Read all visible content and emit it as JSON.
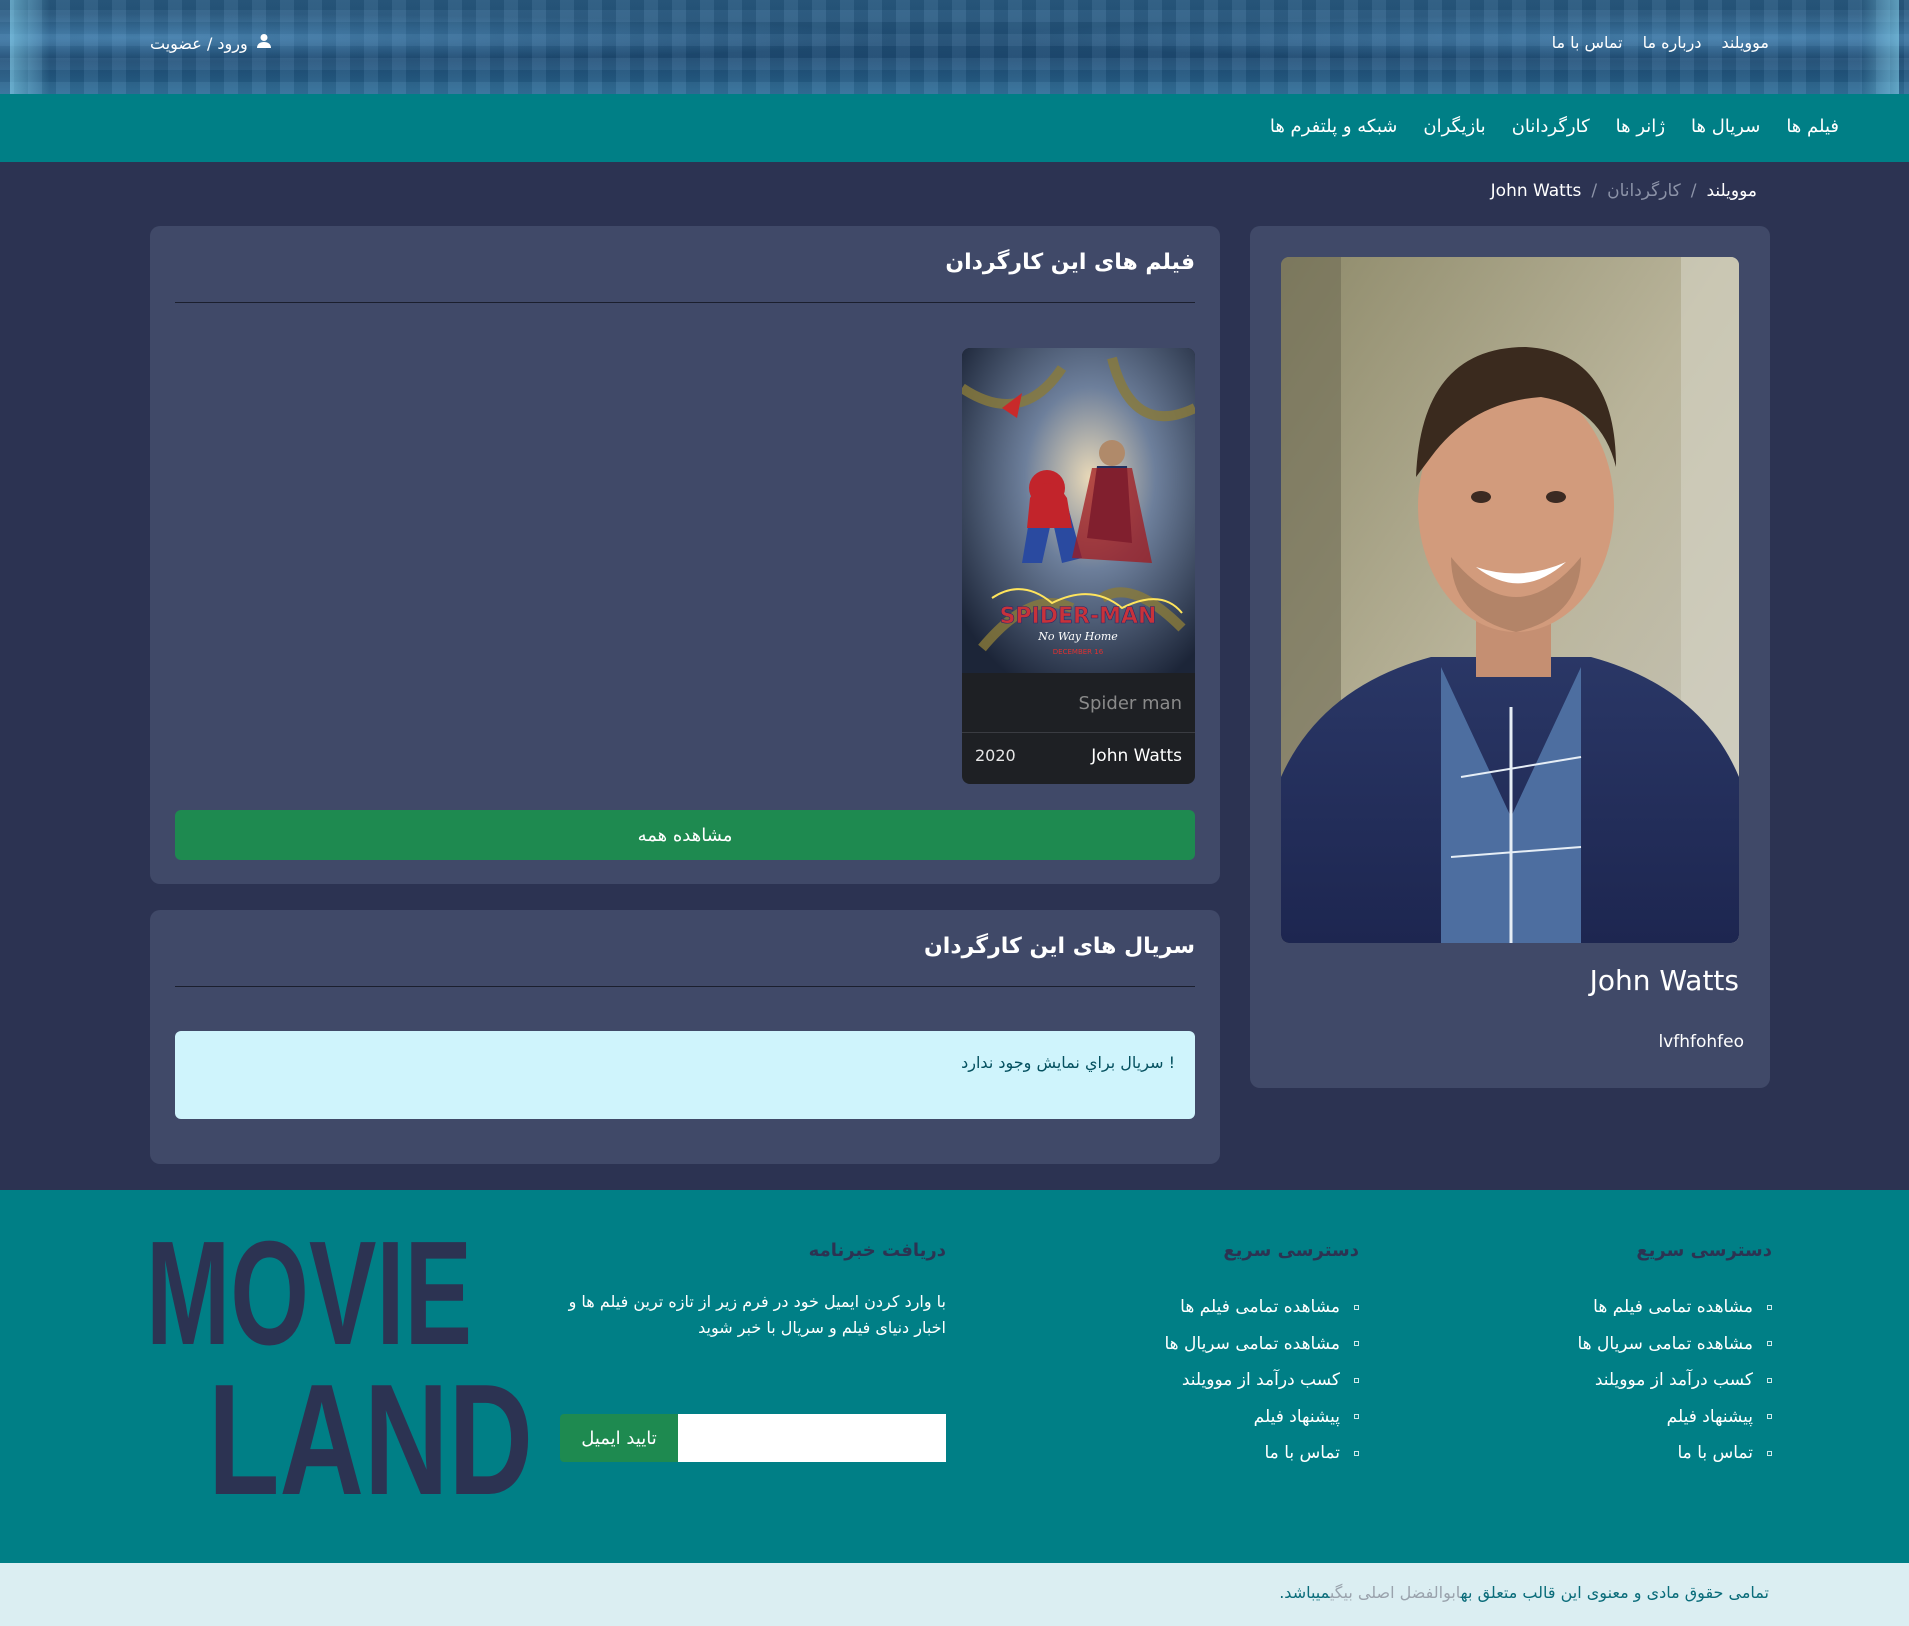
{
  "header": {
    "top_links": [
      "موویلند",
      "درباره ما",
      "تماس با ما"
    ],
    "login_label": "ورود / عضویت"
  },
  "nav": {
    "items": [
      "فیلم ها",
      "سریال ها",
      "ژانر ها",
      "کارگردانان",
      "بازیگران",
      "شبکه و پلتفرم ها"
    ]
  },
  "breadcrumb": {
    "home": "موویلند",
    "section": "کارگردانان",
    "current": "John Watts"
  },
  "profile": {
    "name": "John Watts",
    "bio": "lvfhfohfeo"
  },
  "films": {
    "title": "فیلم های این کارگردان",
    "movies": [
      {
        "title": "Spider man",
        "director": "John Watts",
        "year": "2020"
      }
    ],
    "view_all_label": "مشاهده همه"
  },
  "series": {
    "title": "سریال های این کارگردان",
    "empty_message": "سريال براي نمايش وجود ندارد !"
  },
  "footer": {
    "quick_access_1": {
      "title": "دسترسی سریع",
      "links": [
        "مشاهده تمامی فیلم ها",
        "مشاهده تمامی سریال ها",
        "کسب درآمد از موویلند",
        "پیشنهاد فیلم",
        "تماس با ما"
      ]
    },
    "quick_access_2": {
      "title": "دسترسی سریع",
      "links": [
        "مشاهده تمامی فیلم ها",
        "مشاهده تمامی سریال ها",
        "کسب درآمد از موویلند",
        "پیشنهاد فیلم",
        "تماس با ما"
      ]
    },
    "newsletter": {
      "title": "دریافت خبرنامه",
      "description": "با وارد کردن ایمیل خود در فرم زیر از تازه ترین فیلم ها و اخبار دنیای فیلم و سریال با خبر شوید",
      "email_value": "",
      "submit_label": "تایید ایمیل"
    },
    "logo_text": [
      "MOVIE",
      "LAND"
    ]
  },
  "copyright": {
    "text_before": "تمامی حقوق مادی و معنوی این قالب متعلق به",
    "author": "ابوالفضل اصلی بیگی",
    "text_after": "میباشد."
  },
  "colors": {
    "page_bg": "#2c3352",
    "card_bg": "#404968",
    "teal": "#007f86",
    "green": "#1e8a50",
    "alert_bg": "#cff4fc",
    "copyright_bg": "#dbeef2"
  }
}
